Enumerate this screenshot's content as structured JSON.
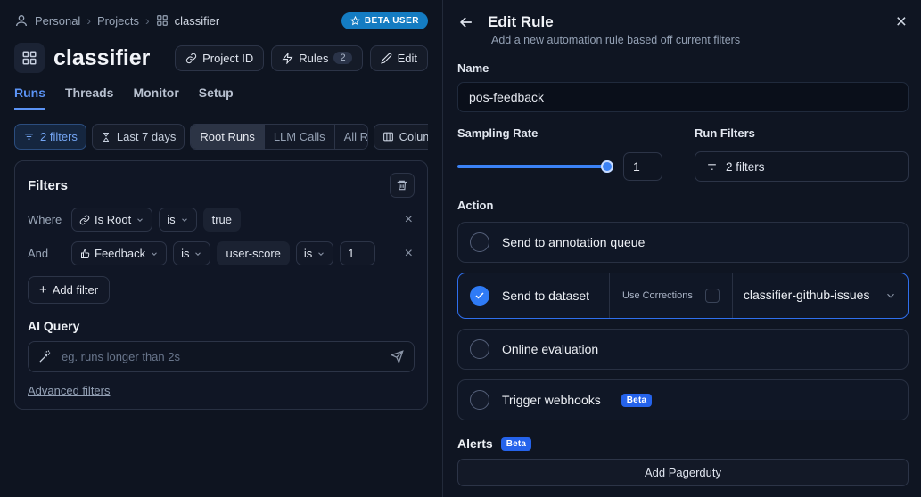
{
  "colors": {
    "accent_blue": "#3b82f6",
    "selected_option_border": "#2f6fed",
    "beta_user_badge_bg": "#147cc2",
    "beta_badge_bg": "#2563eb",
    "active_tab": "#5b93f5",
    "background": "#0e1420"
  },
  "icons": {
    "close": "×",
    "chevron_right": "›",
    "plus": "+"
  },
  "breadcrumb": {
    "items": [
      "Personal",
      "Projects",
      "classifier"
    ],
    "beta_badge": "BETA USER"
  },
  "project": {
    "title": "classifier",
    "project_id": "Project ID",
    "rules": "Rules",
    "rules_count": "2",
    "edit": "Edit"
  },
  "tabs": [
    {
      "label": "Runs",
      "active": true
    },
    {
      "label": "Threads",
      "active": false
    },
    {
      "label": "Monitor",
      "active": false
    },
    {
      "label": "Setup",
      "active": false
    }
  ],
  "toolbar": {
    "filters": "2 filters",
    "date_range": "Last 7 days",
    "seg_root": "Root Runs",
    "seg_llm": "LLM Calls",
    "seg_all": "All R",
    "columns": "Columns"
  },
  "filters": {
    "title": "Filters",
    "row1": {
      "conj": "Where",
      "field": "Is Root",
      "op": "is",
      "value": "true"
    },
    "row2": {
      "conj": "And",
      "field": "Feedback",
      "op": "is",
      "key": "user-score",
      "op2": "is",
      "value": "1"
    },
    "add": "Add filter",
    "ai_label": "AI Query",
    "ai_placeholder": "eg. runs longer than 2s",
    "advanced": "Advanced filters"
  },
  "rule": {
    "title": "Edit Rule",
    "subtitle": "Add a new automation rule based off current filters",
    "name_label": "Name",
    "name_value": "pos-feedback",
    "sampling_label": "Sampling Rate",
    "sampling_value": "1",
    "run_filters_label": "Run Filters",
    "run_filters_value": "2 filters",
    "action_label": "Action",
    "opt1": "Send to annotation queue",
    "opt2": "Send to dataset",
    "use_corrections": "Use Corrections",
    "dataset": "classifier-github-issues",
    "opt3": "Online evaluation",
    "opt4": "Trigger webhooks",
    "beta": "Beta",
    "alerts": "Alerts",
    "add_pagerduty": "Add Pagerduty"
  }
}
